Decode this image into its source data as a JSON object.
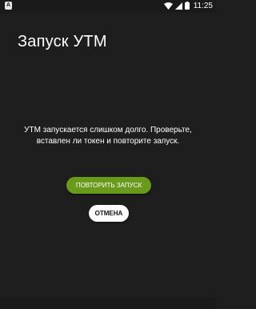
{
  "status_bar": {
    "notification_icon": "a-app-icon",
    "notification_glyph": "A",
    "icons": [
      "wifi-icon",
      "signal-icon",
      "battery-icon"
    ],
    "time": "11:25"
  },
  "page": {
    "title": "Запуск УТМ"
  },
  "message": {
    "text": "УТМ запускается слишком долго. Проверьте, вставлен ли токен и повторите запуск."
  },
  "actions": {
    "retry_label": "ПОВТОРИТЬ ЗАПУСК",
    "cancel_label": "ОТМЕНА"
  },
  "colors": {
    "background": "#1e1e1e",
    "accent": "#6a9a1c",
    "secondary_button": "#ffffff"
  }
}
